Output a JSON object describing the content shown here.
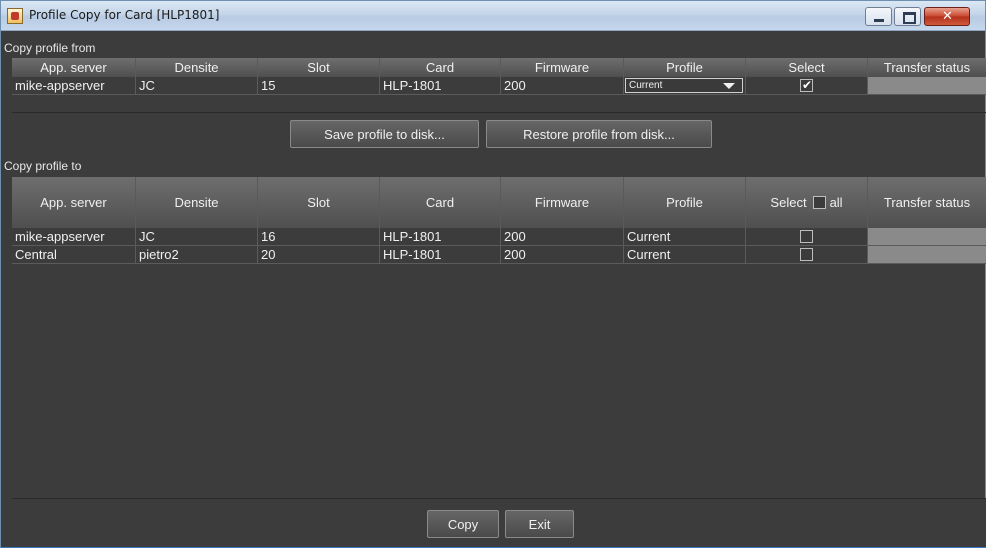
{
  "window": {
    "title": "Profile Copy for Card [HLP1801]",
    "icon": "java-app-icon"
  },
  "from": {
    "section_label": "Copy profile from",
    "columns": [
      "App. server",
      "Densite",
      "Slot",
      "Card",
      "Firmware",
      "Profile",
      "Select",
      "Transfer status"
    ],
    "row": {
      "app_server": "mike-appserver",
      "densite": "JC",
      "slot": "15",
      "card": "HLP-1801",
      "firmware": "200",
      "profile": "Current",
      "selected": true,
      "transfer_status": ""
    }
  },
  "buttons": {
    "save": "Save profile to disk...",
    "restore": "Restore profile from disk...",
    "copy": "Copy",
    "exit": "Exit"
  },
  "to": {
    "section_label": "Copy profile to",
    "columns": [
      "App. server",
      "Densite",
      "Slot",
      "Card",
      "Firmware",
      "Profile",
      "Select",
      "all",
      "Transfer status"
    ],
    "select_all_checked": false,
    "rows": [
      {
        "app_server": "mike-appserver",
        "densite": "JC",
        "slot": "16",
        "card": "HLP-1801",
        "firmware": "200",
        "profile": "Current",
        "selected": false,
        "transfer_status": ""
      },
      {
        "app_server": "Central",
        "densite": "pietro2",
        "slot": "20",
        "card": "HLP-1801",
        "firmware": "200",
        "profile": "Current",
        "selected": false,
        "transfer_status": ""
      }
    ]
  },
  "colors": {
    "background": "#3c3c3c",
    "header": "#5e5e5e",
    "status_cell": "#8a8a8a",
    "titlebar": "#c6d7ec"
  }
}
